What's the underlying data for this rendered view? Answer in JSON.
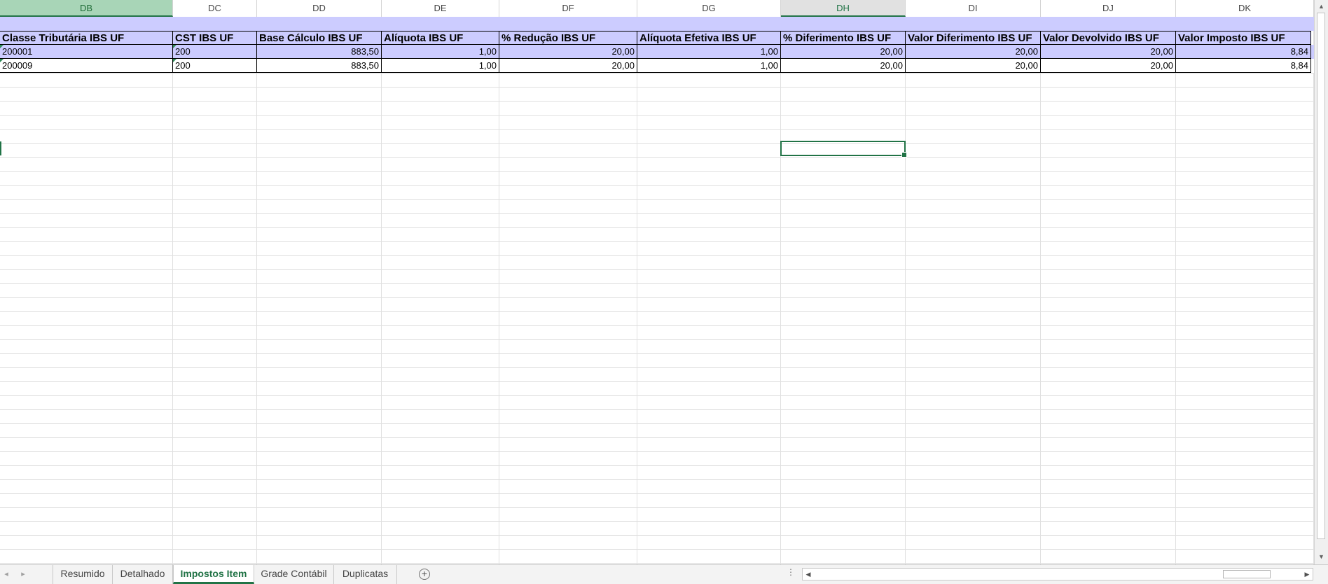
{
  "columns": [
    "DB",
    "DC",
    "DD",
    "DE",
    "DF",
    "DG",
    "DH",
    "DI",
    "DJ",
    "DK"
  ],
  "table": {
    "headers": [
      "Classe Tributária IBS UF",
      "CST IBS UF",
      "Base Cálculo IBS UF",
      "Alíquota IBS UF",
      "% Redução IBS UF",
      "Alíquota Efetiva IBS UF",
      "% Diferimento IBS UF",
      "Valor Diferimento IBS UF",
      "Valor Devolvido IBS UF",
      "Valor Imposto IBS UF"
    ],
    "rows": [
      [
        "200001",
        "200",
        "883,50",
        "1,00",
        "20,00",
        "1,00",
        "20,00",
        "20,00",
        "20,00",
        "8,84"
      ],
      [
        "200009",
        "200",
        "883,50",
        "1,00",
        "20,00",
        "1,00",
        "20,00",
        "20,00",
        "20,00",
        "8,84"
      ]
    ]
  },
  "sheet_tabs": {
    "items": [
      "Resumido",
      "Detalhado",
      "Impostos Item",
      "Grade Contábil",
      "Duplicatas"
    ],
    "active": "Impostos Item"
  },
  "colors": {
    "header_band": "#ccccff",
    "accent": "#217346"
  },
  "icons": {
    "nav_prev": "◂",
    "nav_next": "▸",
    "add_sheet": "+",
    "split": "⋮",
    "scroll_up": "▲",
    "scroll_down": "▼",
    "scroll_left": "◀",
    "scroll_right": "▶"
  }
}
